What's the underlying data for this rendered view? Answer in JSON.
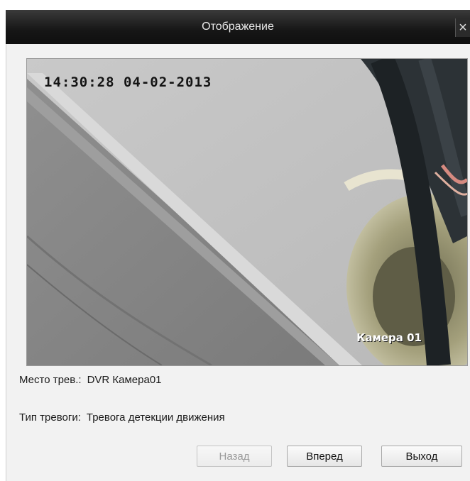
{
  "window": {
    "title": "Отображение",
    "close_glyph": "×"
  },
  "video": {
    "timestamp": "14:30:28 04-02-2013",
    "camera_overlay": "Камера 01"
  },
  "info": {
    "location_label": "Место трев.:",
    "location_value": "DVR Камера01",
    "type_label": "Тип тревоги:",
    "type_value": "Тревога детекции движения"
  },
  "buttons": {
    "back": "Назад",
    "forward": "Вперед",
    "exit": "Выход"
  },
  "icons": {
    "close": "close-icon"
  }
}
